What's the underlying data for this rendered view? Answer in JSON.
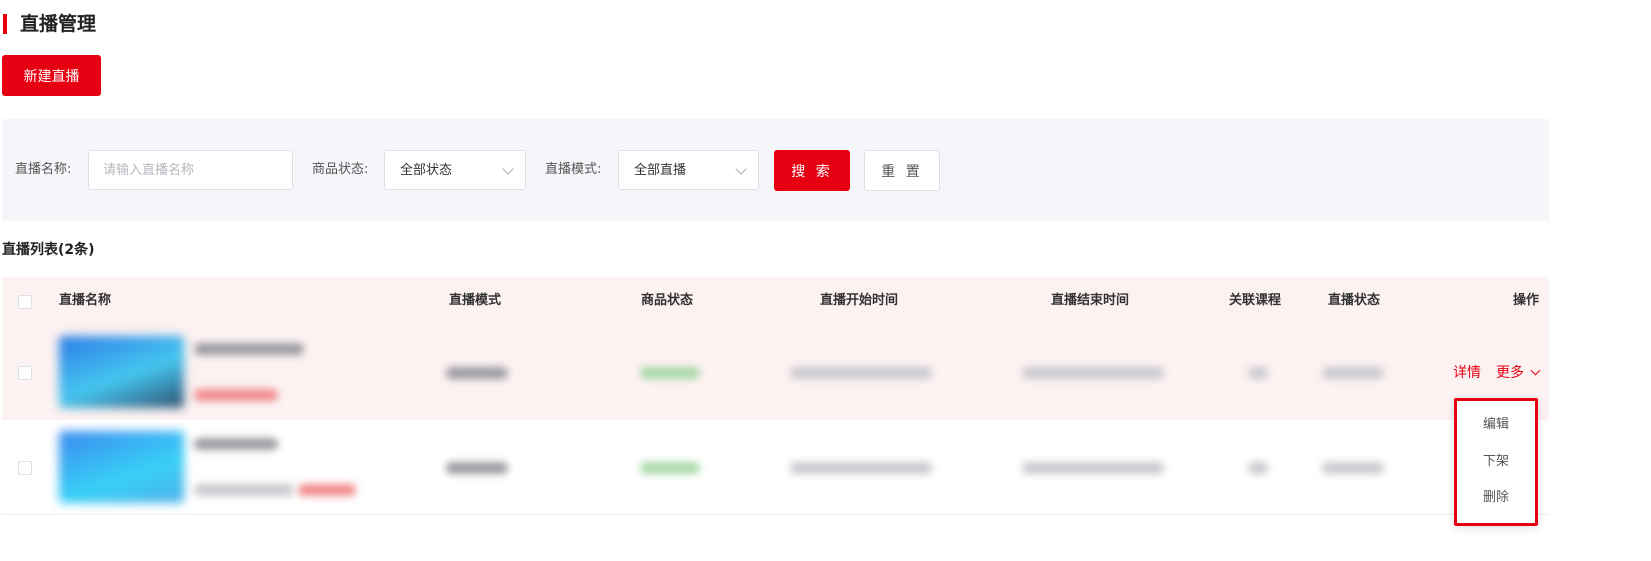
{
  "page": {
    "title": "直播管理"
  },
  "actions": {
    "new_live_label": "新建直播"
  },
  "filters": {
    "name_label": "直播名称:",
    "name_placeholder": "请输入直播名称",
    "name_value": "",
    "status_label": "商品状态:",
    "status_value": "全部状态",
    "mode_label": "直播模式:",
    "mode_value": "全部直播",
    "search_label": "搜 索",
    "reset_label": "重 置"
  },
  "list": {
    "title": "直播列表(2条)",
    "columns": [
      "直播名称",
      "直播模式",
      "商品状态",
      "直播开始时间",
      "直播结束时间",
      "关联课程",
      "直播状态",
      "操作"
    ],
    "row_actions": {
      "detail_label": "详情",
      "more_label": "更多"
    }
  },
  "dropdown": {
    "items": [
      "编辑",
      "下架",
      "删除"
    ]
  },
  "colors": {
    "accent": "#e60012",
    "header_bg": "#fdf2f2",
    "filter_bg": "#f5f6f9"
  }
}
